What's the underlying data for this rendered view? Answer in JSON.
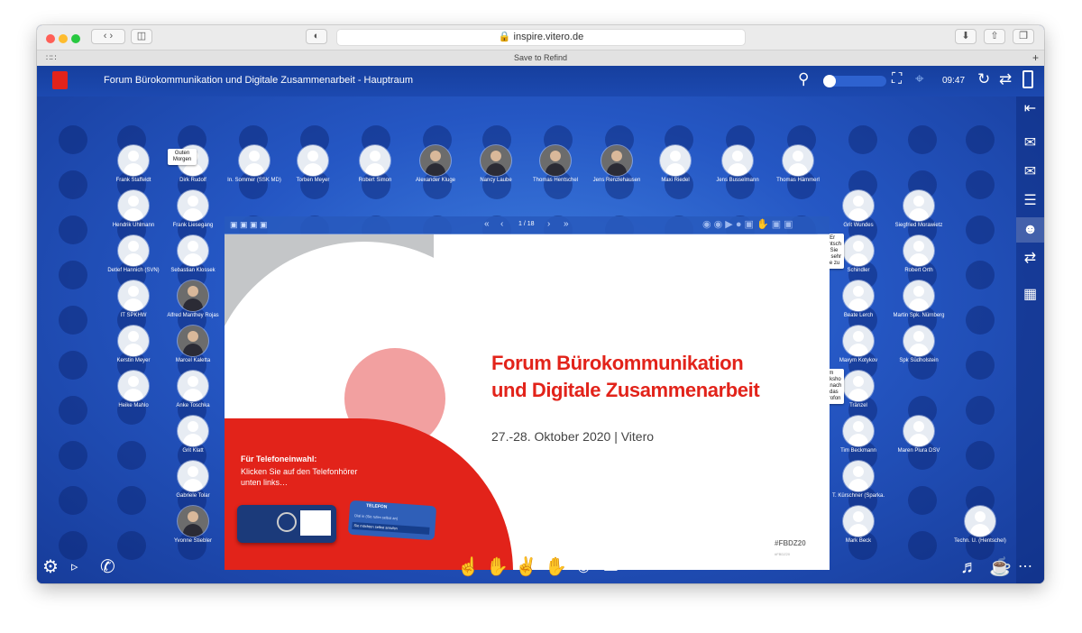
{
  "browser": {
    "url": "inspire.vitero.de",
    "bookmark": "Save to Refind"
  },
  "app": {
    "title": "Forum Bürokommunikation und Digitale Zusammenarbeit - Hauptraum",
    "time": "09:47"
  },
  "participants_top": [
    {
      "name": "Frank Staffeldt"
    },
    {
      "name": "Dirk Rudolf",
      "bubble": "Guten Morgen"
    },
    {
      "name": "In. Sommer (SSK MD)"
    },
    {
      "name": "Torben Meyer"
    },
    {
      "name": "Robert Simon"
    },
    {
      "name": "Alexander Kluge"
    },
    {
      "name": "Nancy Laube"
    },
    {
      "name": "Thomas Hentschel"
    },
    {
      "name": "Jens Renzlehausen"
    },
    {
      "name": "Maxi Riedel"
    },
    {
      "name": "Jens Busselmann"
    },
    {
      "name": "Thomas Hämmerl"
    }
  ],
  "participants_left": [
    {
      "name": "Hendrik Uhlmann"
    },
    {
      "name": "Frank Liesegang"
    },
    {
      "name": "Detlef Hannich (SVN)"
    },
    {
      "name": "Sebastian Klossek"
    },
    {
      "name": "IT SPKHW"
    },
    {
      "name": "Alfred Manthey Rojas"
    },
    {
      "name": "Kerstin Meyer"
    },
    {
      "name": "Marcel Kaletta"
    },
    {
      "name": "Heike Mahlo"
    },
    {
      "name": "Anke Toschka"
    },
    {
      "name": "Grit Klatt"
    },
    {
      "name": "Gabriele Tolar"
    },
    {
      "name": "Yvonne Stiebler"
    }
  ],
  "participants_right": [
    {
      "name": "Grit Wundes"
    },
    {
      "name": "Siegfried Morawietz"
    },
    {
      "name": "Schindler",
      "bubble": "HEr rHentsch el, Sie sind sehr leise zu"
    },
    {
      "name": "Robert Orth"
    },
    {
      "name": "Beate Lerch"
    },
    {
      "name": "Martin Spk. Nürnberg"
    },
    {
      "name": "Maxym Kotykov"
    },
    {
      "name": "Spk Südholstein"
    },
    {
      "name": "Tränzel",
      "bubble": "Im Worksho p danach ist das Mikrofon"
    },
    {
      "name": "Tim Beckmann"
    },
    {
      "name": "Maren Plura DSV"
    },
    {
      "name": "T. Kürschner (Sparka."
    },
    {
      "name": "Mark Beck"
    },
    {
      "name": "Techn. U. (Hentschel)"
    }
  ],
  "slide": {
    "page": "1 / 18",
    "title_line1": "Forum Bürokommunikation",
    "title_line2": "und Digitale Zusammenarbeit",
    "date": "27.-28. Oktober 2020 | Vitero",
    "phone_heading": "Für Telefoneinwahl:",
    "phone_text1": "Klicken Sie auf den Telefonhörer",
    "phone_text2": "unten links…",
    "phone_card_label": "TELEFON",
    "phone_card_line1": "Dial in (Sie rufen selbst an)",
    "phone_card_line2": "Sie möchten selbst anrufen",
    "hashtag": "#FBDZ20",
    "hashtag_small": "#FBDZ20"
  },
  "colors": {
    "accent_red": "#e2231a",
    "app_blue": "#1e4cb6",
    "slide_grey": "#c4c6c8",
    "circle_pink": "#f2a0a0"
  }
}
